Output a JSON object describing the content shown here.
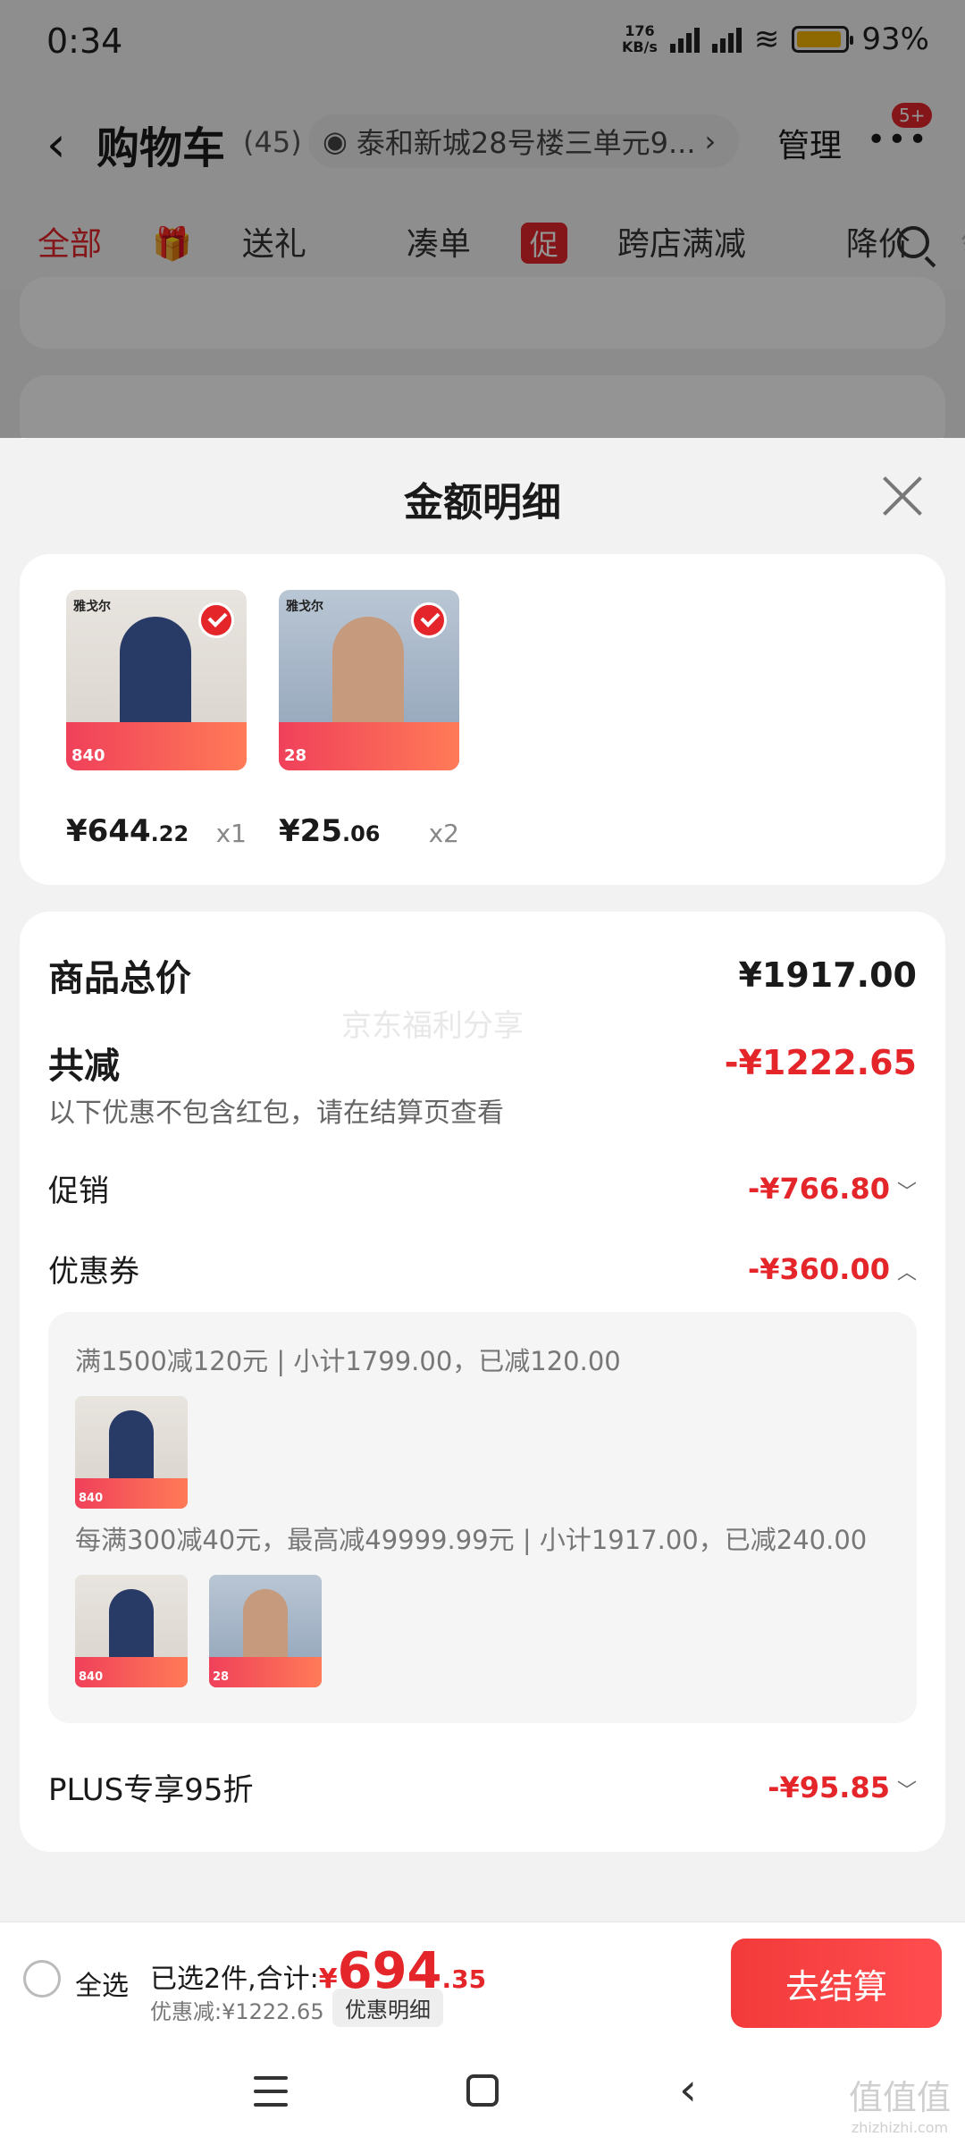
{
  "status_bar": {
    "time": "0:34",
    "net_speed_value": "176",
    "net_speed_unit": "KB/s",
    "battery": "93%",
    "battery_level": 0.93
  },
  "header": {
    "title": "购物车",
    "count": "(45)",
    "address": "泰和新城28号楼三单元9...",
    "manage": "管理",
    "notification_badge": "5+"
  },
  "filters": [
    {
      "label": "全部",
      "active": true
    },
    {
      "label": "送礼",
      "icon": "gift-icon"
    },
    {
      "label": "凑单"
    },
    {
      "label": "跨店满减",
      "tag": "促"
    },
    {
      "label": "降价"
    },
    {
      "label": "领"
    }
  ],
  "sheet": {
    "title": "金额明细",
    "products": [
      {
        "brand": "雅戈尔",
        "image_price": "840",
        "price_int": "¥644",
        "price_dec": ".22",
        "qty": "x1"
      },
      {
        "brand": "雅戈尔",
        "image_price": "28",
        "price_int": "¥25",
        "price_dec": ".06",
        "qty": "x2"
      }
    ],
    "watermark": "京东福利分享",
    "total_label": "商品总价",
    "total_value": "¥1917.00",
    "discount_label": "共减",
    "discount_value": "-¥1222.65",
    "note": "以下优惠不包含红包，请在结算页查看",
    "promo_label": "促销",
    "promo_value": "-¥766.80",
    "coupon_label": "优惠券",
    "coupon_value": "-¥360.00",
    "coupon_rules": [
      "满1500减120元 | 小计1799.00，已减120.00",
      "每满300减40元，最高减49999.99元 | 小计1917.00，已减240.00"
    ],
    "plus_label": "PLUS专享95折",
    "plus_value": "-¥95.85"
  },
  "bottom_bar": {
    "select_all": "全选",
    "selected_text": "已选2件,合计:",
    "total_symbol": "¥",
    "total_int": "694",
    "total_dec": ".35",
    "saved_text": "优惠减:¥1222.65",
    "detail_button": "优惠明细",
    "checkout": "去结算"
  },
  "corner_logo": {
    "text": "值值值",
    "url": "zhizhizhi.com"
  },
  "colors": {
    "accent": "#e4262b"
  }
}
